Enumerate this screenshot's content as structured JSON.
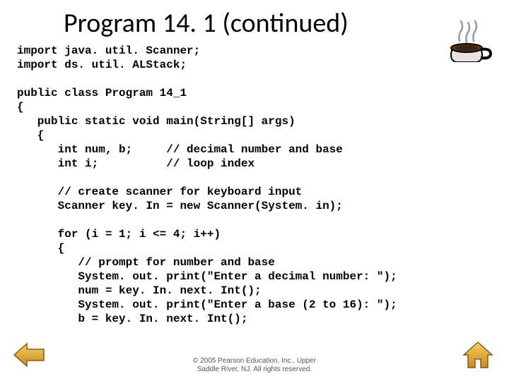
{
  "title": "Program 14. 1 (continued)",
  "code": "import java. util. Scanner;\nimport ds. util. ALStack;\n\npublic class Program 14_1\n{\n   public static void main(String[] args)\n   {\n      int num, b;     // decimal number and base\n      int i;          // loop index\n\n      // create scanner for keyboard input\n      Scanner key. In = new Scanner(System. in);\n\n      for (i = 1; i <= 4; i++)\n      {\n         // prompt for number and base\n         System. out. print(\"Enter a decimal number: \");\n         num = key. In. next. Int();\n         System. out. print(\"Enter a base (2 to 16): \");\n         b = key. In. next. Int();",
  "footer_line1": "© 2005 Pearson Education, Inc., Upper",
  "footer_line2": "Saddle River, NJ. All rights reserved."
}
